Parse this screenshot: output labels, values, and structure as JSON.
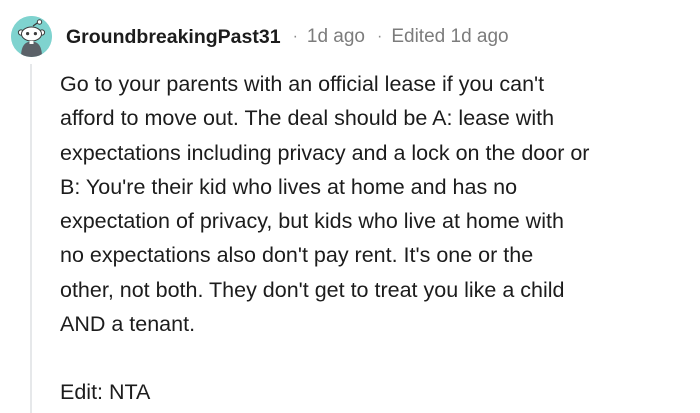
{
  "comment": {
    "username": "GroundbreakingPast31",
    "separator": "·",
    "posted": "1d ago",
    "edited": "Edited 1d ago",
    "paragraphs": [
      "Go to your parents with an official lease if you can't\nafford to move out. The deal should be A: lease with\nexpectations including privacy and a lock on the door or\nB: You're their kid who lives at home and has no\nexpectation of privacy, but kids who live at home with\nno expectations also don't pay rent. It's one or the\nother, not both. They don't get to treat you like a child\nAND a tenant.",
      "Edit: NTA"
    ]
  },
  "colors": {
    "avatar_background": "#7fd3cf",
    "username": "#1c1c1c",
    "meta": "#7c7c7c",
    "body_text": "#1c1c1c",
    "thread_line": "#e6e8ea"
  },
  "icons": {
    "avatar": "reddit-snoo-avatar-icon"
  }
}
